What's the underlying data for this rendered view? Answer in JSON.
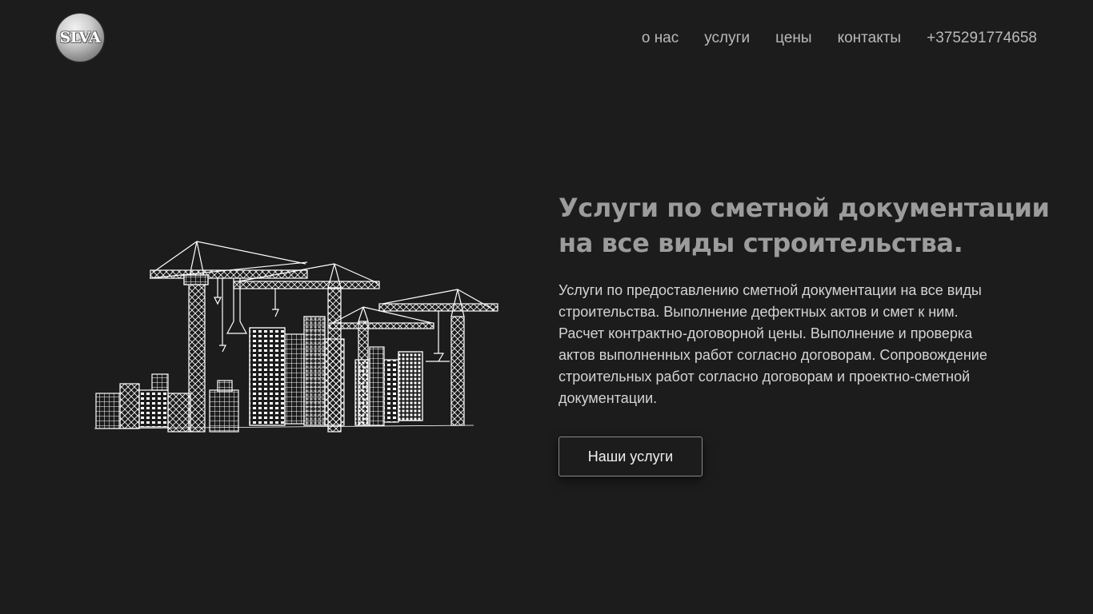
{
  "header": {
    "logo_text": "SLVA",
    "nav": [
      {
        "label": "о нас"
      },
      {
        "label": "услуги"
      },
      {
        "label": "цены"
      },
      {
        "label": "контакты"
      },
      {
        "label": "+375291774658"
      }
    ]
  },
  "hero": {
    "title_lines": [
      "Услуги по сметной документации",
      "на все виды строительства."
    ],
    "description_lines": [
      "Услуги по предоставлению сметной документации на все виды",
      "строительства. Выполнение дефектных актов и смет к ним.",
      "Расчет контрактно-договорной цены. Выполнение и проверка",
      "актов выполненных работ согласно договорам. Сопровождение",
      "строительных работ согласно договорам и проектно-сметной",
      "документации."
    ],
    "button_label": "Наши услуги",
    "illustration": "construction-cranes-sketch"
  },
  "colors": {
    "background": "#1c1c1d",
    "nav_text": "#b9b9b9",
    "title": "#9c9c9c",
    "body_text": "#d4d4d4"
  }
}
